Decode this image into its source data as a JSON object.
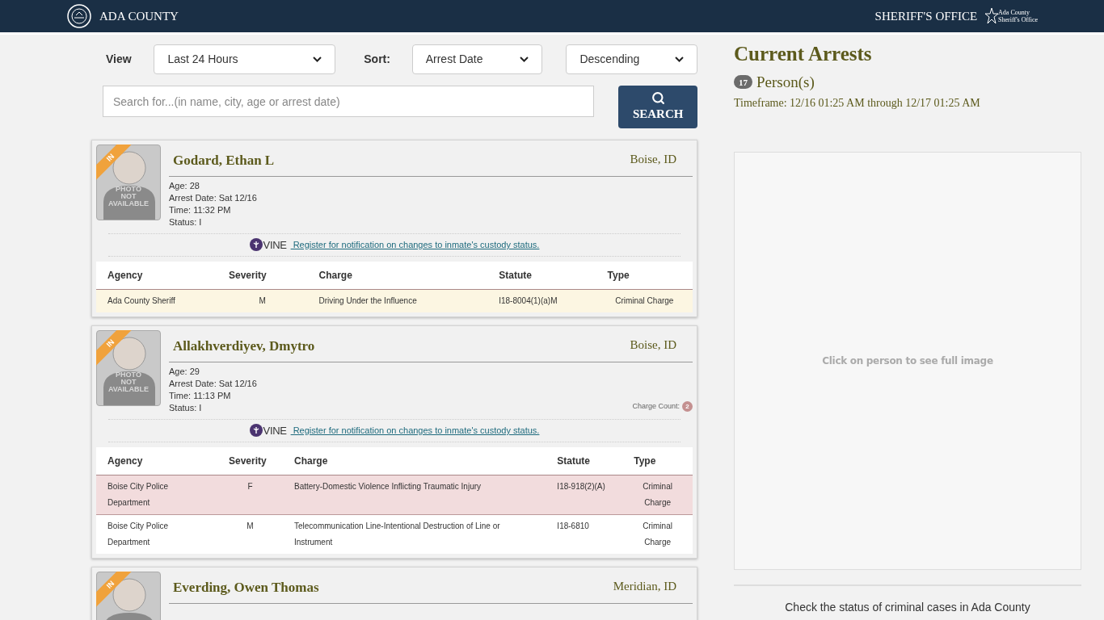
{
  "header": {
    "site": "ADA COUNTY",
    "office": "SHERIFF'S OFFICE",
    "logo_text": [
      "Ada County",
      "Sheriff's Office"
    ]
  },
  "filters": {
    "view_label": "View",
    "view_value": "Last 24 Hours",
    "sort_label": "Sort:",
    "sort_value": "Arrest Date",
    "order_value": "Descending"
  },
  "search": {
    "placeholder": "Search for...(in name, city, age or arrest date)",
    "button": "SEARCH"
  },
  "cards": [
    {
      "badge": "IN",
      "photo_label": [
        "PHOTO",
        "NOT",
        "AVAILABLE"
      ],
      "name": "Godard, Ethan L",
      "location": "Boise, ID",
      "details": [
        "Age: 28",
        "Arrest Date: Sat 12/16",
        "Time: 11:32 PM",
        "Status: I"
      ],
      "vine": "VINE",
      "vine_link": " Register for notification on changes to inmate's custody status.",
      "columns": [
        "Agency",
        "Severity",
        "Charge",
        "Statute",
        "Type"
      ],
      "charges": [
        {
          "agency": "Ada County Sheriff",
          "severity": "M",
          "charge": "Driving Under the Influence",
          "statute": "I18-8004(1)(a)M",
          "type": "Criminal Charge",
          "color": "#fcf6e2"
        }
      ]
    },
    {
      "badge": "IN",
      "photo_label": [
        "PHOTO",
        "NOT",
        "AVAILABLE"
      ],
      "name": "Allakhverdiyev, Dmytro",
      "location": "Boise, ID",
      "details": [
        "Age: 29",
        "Arrest Date: Sat 12/16",
        "Time: 11:13 PM",
        "Status: I"
      ],
      "charge_count_label": "Charge Count:",
      "charge_count": "2",
      "vine": "VINE",
      "vine_link": " Register for notification on changes to inmate's custody status.",
      "columns": [
        "Agency",
        "Severity",
        "Charge",
        "Statute",
        "Type"
      ],
      "charges": [
        {
          "agency": "Boise City Police Department",
          "severity": "F",
          "charge": "Battery-Domestic Violence Inflicting Traumatic Injury",
          "statute": "I18-918(2)(A)",
          "type": "Criminal Charge",
          "color": "#f2dcdd"
        },
        {
          "agency": "Boise City Police Department",
          "severity": "M",
          "charge": "Telecommunication Line-Intentional Destruction of Line or Instrument",
          "statute": "I18-6810",
          "type": "Criminal Charge",
          "color": "#ffffff"
        }
      ]
    },
    {
      "badge": "IN",
      "name": "Everding, Owen Thomas",
      "location": "Meridian, ID"
    }
  ],
  "summary": {
    "title": "Current Arrests",
    "count": "17",
    "count_label": "Person(s)",
    "timeframe": "Timeframe: 12/16 01:25 AM through 12/17 01:25 AM"
  },
  "image_panel": {
    "hint": "Click on person to see full image"
  },
  "footer_text": "Check the status of criminal cases in Ada County"
}
